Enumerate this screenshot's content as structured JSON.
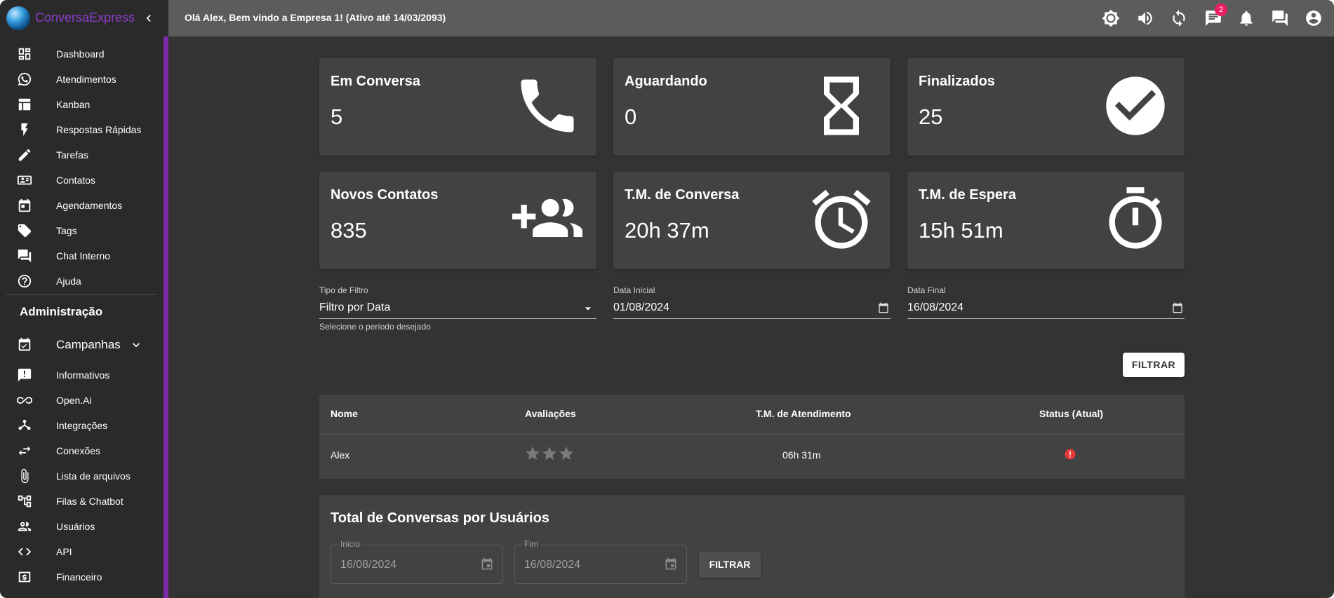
{
  "brand": {
    "name": "ConversaExpress"
  },
  "header": {
    "welcome": "Olá Alex, Bem vindo a Empresa 1! (Ativo até 14/03/2093)",
    "chat_badge": "2"
  },
  "sidebar": {
    "items": [
      {
        "label": "Dashboard",
        "icon": "dashboard-icon"
      },
      {
        "label": "Atendimentos",
        "icon": "whatsapp-icon"
      },
      {
        "label": "Kanban",
        "icon": "kanban-icon"
      },
      {
        "label": "Respostas Rápidas",
        "icon": "bolt-icon"
      },
      {
        "label": "Tarefas",
        "icon": "pencil-icon"
      },
      {
        "label": "Contatos",
        "icon": "contact-card-icon"
      },
      {
        "label": "Agendamentos",
        "icon": "calendar-icon"
      },
      {
        "label": "Tags",
        "icon": "tag-icon"
      },
      {
        "label": "Chat Interno",
        "icon": "forum-icon"
      },
      {
        "label": "Ajuda",
        "icon": "help-icon"
      }
    ],
    "admin_title": "Administração",
    "admin_items": [
      {
        "label": "Campanhas",
        "icon": "event-check-icon"
      },
      {
        "label": "Informativos",
        "icon": "announcement-icon"
      },
      {
        "label": "Open.Ai",
        "icon": "infinity-icon"
      },
      {
        "label": "Integrações",
        "icon": "hub-icon"
      },
      {
        "label": "Conexões",
        "icon": "swap-icon"
      },
      {
        "label": "Lista de arquivos",
        "icon": "paperclip-icon"
      },
      {
        "label": "Filas & Chatbot",
        "icon": "tree-icon"
      },
      {
        "label": "Usuários",
        "icon": "people-icon"
      },
      {
        "label": "API",
        "icon": "code-icon"
      },
      {
        "label": "Financeiro",
        "icon": "money-icon"
      }
    ]
  },
  "cards": [
    {
      "title": "Em Conversa",
      "value": "5",
      "icon": "phone-icon"
    },
    {
      "title": "Aguardando",
      "value": "0",
      "icon": "hourglass-icon"
    },
    {
      "title": "Finalizados",
      "value": "25",
      "icon": "check-circle-icon"
    },
    {
      "title": "Novos Contatos",
      "value": "835",
      "icon": "group-add-icon"
    },
    {
      "title": "T.M. de Conversa",
      "value": "20h 37m",
      "icon": "alarm-icon"
    },
    {
      "title": "T.M. de Espera",
      "value": "15h 51m",
      "icon": "timer-icon"
    }
  ],
  "filters": {
    "tipo_label": "Tipo de Filtro",
    "tipo_value": "Filtro por Data",
    "tipo_helper": "Selecione o período desejado",
    "data_inicial_label": "Data Inicial",
    "data_inicial_value": "01/08/2024",
    "data_final_label": "Data Final",
    "data_final_value": "16/08/2024",
    "button": "FILTRAR"
  },
  "table": {
    "columns": [
      "Nome",
      "Avaliações",
      "T.M. de Atendimento",
      "Status (Atual)"
    ],
    "rows": [
      {
        "nome": "Alex",
        "avaliacoes": 0,
        "tm": "06h 31m",
        "status_color": "#e53935"
      }
    ]
  },
  "panel": {
    "title": "Total de Conversas por Usuários",
    "inicio_label": "Inicio",
    "inicio_value": "16/08/2024",
    "fim_label": "Fim",
    "fim_value": "16/08/2024",
    "button": "FILTRAR"
  }
}
